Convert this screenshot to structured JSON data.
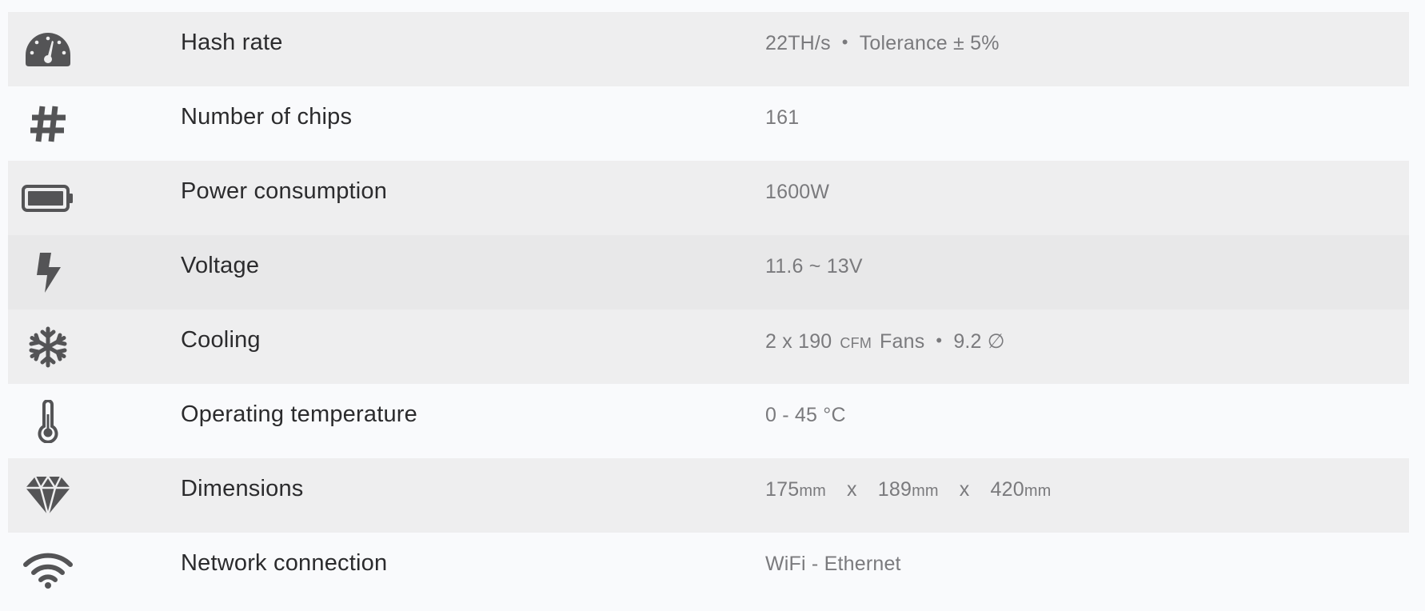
{
  "colors": {
    "row_shade_a": "#eeeeef",
    "row_shade_b": "#f9fafc",
    "row_shade_c": "#e8e8e9",
    "icon": "#545456",
    "label": "#2b2b2d",
    "value": "#7a7a7d"
  },
  "rows": [
    {
      "icon": "speedometer-icon",
      "label": "Hash rate",
      "value_main": "22TH/s",
      "value_sep": "•",
      "value_extra": "Tolerance ± 5%"
    },
    {
      "icon": "hashtag-icon",
      "label": "Number of chips",
      "value": "161"
    },
    {
      "icon": "battery-icon",
      "label": "Power consumption",
      "value": "1600W"
    },
    {
      "icon": "lightning-bolt-icon",
      "label": "Voltage",
      "value": "11.6 ~ 13V"
    },
    {
      "icon": "snowflake-icon",
      "label": "Cooling",
      "value_count": "2 x 190",
      "value_unit": "CFM",
      "value_fans": "Fans",
      "value_sep": "•",
      "value_size": "9.2 ∅"
    },
    {
      "icon": "thermometer-icon",
      "label": "Operating temperature",
      "value": "0 - 45 °C"
    },
    {
      "icon": "diamond-icon",
      "label": "Dimensions",
      "dim_a": "175",
      "dim_b": "189",
      "dim_c": "420",
      "dim_unit": "mm",
      "dim_times": "x"
    },
    {
      "icon": "wifi-icon",
      "label": "Network connection",
      "value": "WiFi - Ethernet"
    }
  ]
}
